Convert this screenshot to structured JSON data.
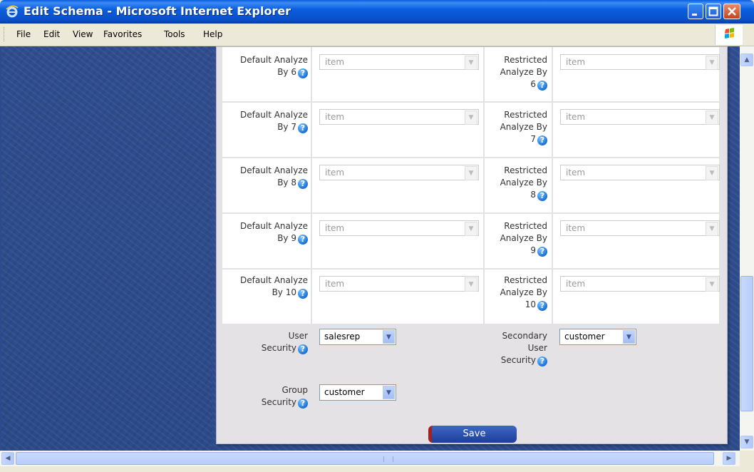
{
  "window": {
    "title": "Edit Schema - Microsoft Internet Explorer"
  },
  "menu": [
    "File",
    "Edit",
    "View",
    "Favorites",
    "Tools",
    "Help"
  ],
  "analyze_rows": [
    {
      "default_label_1": "Default Analyze",
      "default_label_2": "By 6",
      "default_value": "item",
      "restricted_label_1": "Restricted",
      "restricted_label_2": "Analyze By",
      "restricted_label_3": "6",
      "restricted_value": "item"
    },
    {
      "default_label_1": "Default Analyze",
      "default_label_2": "By 7",
      "default_value": "item",
      "restricted_label_1": "Restricted",
      "restricted_label_2": "Analyze By",
      "restricted_label_3": "7",
      "restricted_value": "item"
    },
    {
      "default_label_1": "Default Analyze",
      "default_label_2": "By 8",
      "default_value": "item",
      "restricted_label_1": "Restricted",
      "restricted_label_2": "Analyze By",
      "restricted_label_3": "8",
      "restricted_value": "item"
    },
    {
      "default_label_1": "Default Analyze",
      "default_label_2": "By 9",
      "default_value": "item",
      "restricted_label_1": "Restricted",
      "restricted_label_2": "Analyze By",
      "restricted_label_3": "9",
      "restricted_value": "item"
    },
    {
      "default_label_1": "Default Analyze",
      "default_label_2": "By 10",
      "default_value": "item",
      "restricted_label_1": "Restricted",
      "restricted_label_2": "Analyze By",
      "restricted_label_3": "10",
      "restricted_value": "item"
    }
  ],
  "security": {
    "user_label_1": "User",
    "user_label_2": "Security",
    "user_value": "salesrep",
    "secondary_label_1": "Secondary",
    "secondary_label_2": "User",
    "secondary_label_3": "Security",
    "secondary_value": "customer",
    "group_label_1": "Group",
    "group_label_2": "Security",
    "group_value": "customer"
  },
  "save_label": "Save",
  "icons": {
    "help": "help-icon",
    "dropdown": "chevron-down-icon"
  }
}
